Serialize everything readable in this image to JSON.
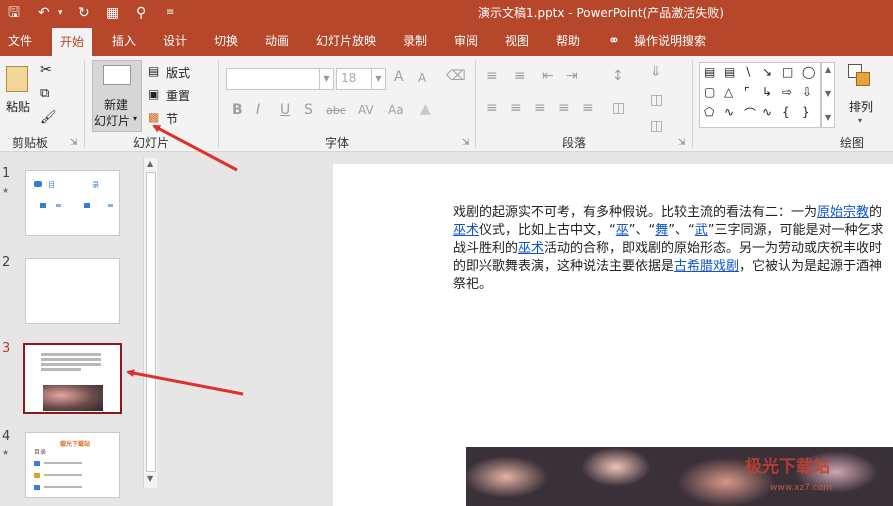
{
  "titlebar": {
    "title": "演示文稿1.pptx  -  PowerPoint(产品激活失败)",
    "quick_access": [
      "save-icon",
      "undo-icon",
      "redo-icon",
      "present-icon",
      "print-preview-icon",
      "customize-icon"
    ]
  },
  "tabs": [
    "文件",
    "开始",
    "插入",
    "设计",
    "切换",
    "动画",
    "幻灯片放映",
    "录制",
    "审阅",
    "视图",
    "帮助",
    "操作说明搜索"
  ],
  "active_tab": "开始",
  "ribbon": {
    "clipboard": {
      "paste": "粘贴",
      "group": "剪贴板"
    },
    "slides": {
      "new_line1": "新建",
      "new_line2": "幻灯片",
      "layout": "版式",
      "reset": "重置",
      "section": "节",
      "group": "幻灯片"
    },
    "font": {
      "font_size": "18",
      "bold": "B",
      "italic": "I",
      "underline": "U",
      "shadow": "S",
      "strike": "abc",
      "spacing": "AV",
      "case": "Aa",
      "grow": "A",
      "shrink": "A",
      "group": "字体"
    },
    "paragraph": {
      "group": "段落"
    },
    "drawing": {
      "arrange": "排列",
      "group": "绘图"
    }
  },
  "slides_panel": {
    "slides": [
      {
        "number": "1",
        "has_star": true,
        "thumb_text": [
          "目",
          "录"
        ]
      },
      {
        "number": "2",
        "has_star": false
      },
      {
        "number": "3",
        "has_star": false,
        "selected": true
      },
      {
        "number": "4",
        "has_star": true,
        "thumb_text": [
          "载光下载站",
          "目录"
        ]
      }
    ]
  },
  "slide": {
    "text_runs": [
      {
        "t": "戏剧的起源实不可考，有多种假说。比较主流的看法有二：一为"
      },
      {
        "t": "原始宗教",
        "link": true
      },
      {
        "t": "的"
      },
      {
        "t": "巫术",
        "link": true
      },
      {
        "t": "仪式，比如上古中文，“"
      },
      {
        "t": "巫",
        "link": true
      },
      {
        "t": "”、“"
      },
      {
        "t": "舞",
        "link": true
      },
      {
        "t": "”、“"
      },
      {
        "t": "武",
        "link": true
      },
      {
        "t": "”三字同源，可能是对一种乞求战斗胜利的"
      },
      {
        "t": "巫术",
        "link": true
      },
      {
        "t": "活动的合称，即戏剧的原始形态。另一为劳动或庆祝丰收时的即兴歌舞表演，这种说法主要依据是"
      },
      {
        "t": "古希腊戏剧",
        "link": true
      },
      {
        "t": "，它被认为是起源于酒神祭祀。"
      }
    ]
  },
  "watermark": {
    "line1": "极光下载站",
    "line2": "www.xz7.com"
  },
  "colors": {
    "accent": "#b7472a",
    "link": "#1155cc",
    "selection": "#8b1a1a",
    "arrow": "#e0302a"
  }
}
